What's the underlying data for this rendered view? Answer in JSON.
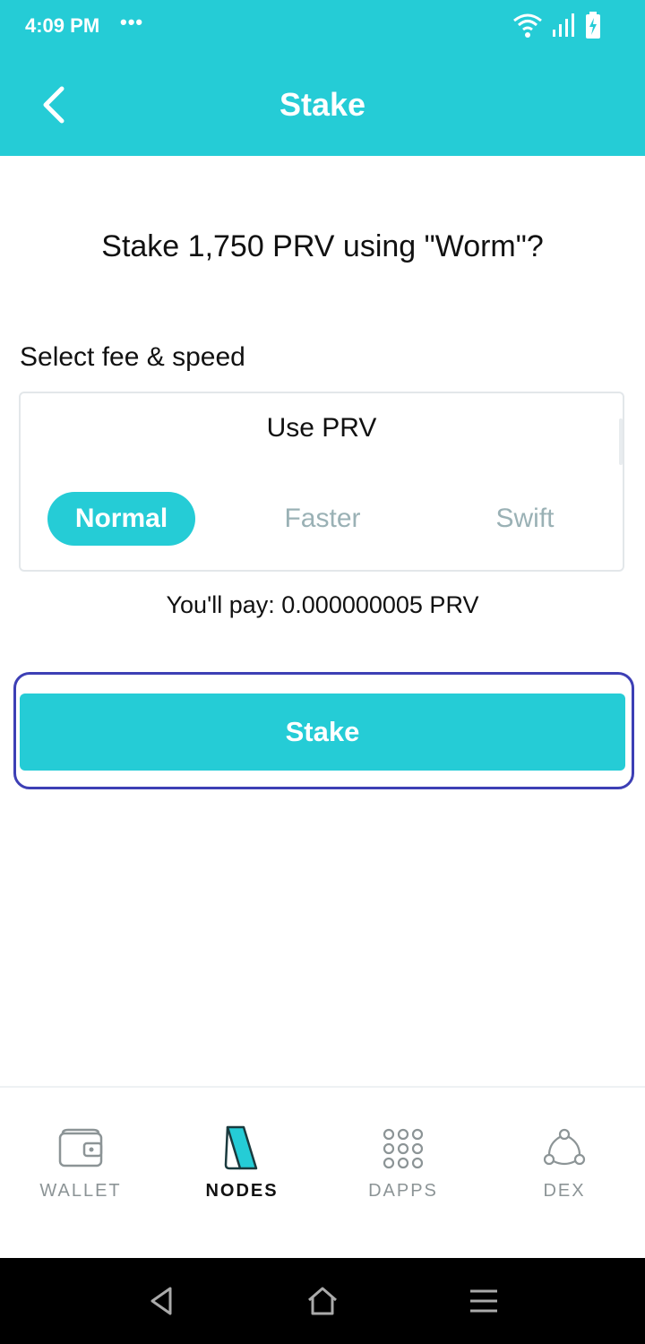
{
  "status_bar": {
    "time": "4:09 PM",
    "dots": "•••"
  },
  "header": {
    "title": "Stake"
  },
  "confirm": {
    "question": "Stake 1,750 PRV using \"Worm\"?"
  },
  "fee": {
    "label": "Select fee & speed",
    "token": "Use PRV",
    "speeds": [
      "Normal",
      "Faster",
      "Swift"
    ],
    "selected": "Normal",
    "pay_line": "You'll pay: 0.000000005 PRV"
  },
  "actions": {
    "stake_label": "Stake"
  },
  "tabs": [
    {
      "label": "WALLET",
      "icon": "wallet-icon",
      "active": false
    },
    {
      "label": "NODES",
      "icon": "nodes-icon",
      "active": true
    },
    {
      "label": "DAPPS",
      "icon": "grid-icon",
      "active": false
    },
    {
      "label": "DEX",
      "icon": "dex-icon",
      "active": false
    }
  ],
  "colors": {
    "accent": "#25ccd6",
    "focus": "#3d3fb5",
    "muted": "#9ab1b5"
  }
}
